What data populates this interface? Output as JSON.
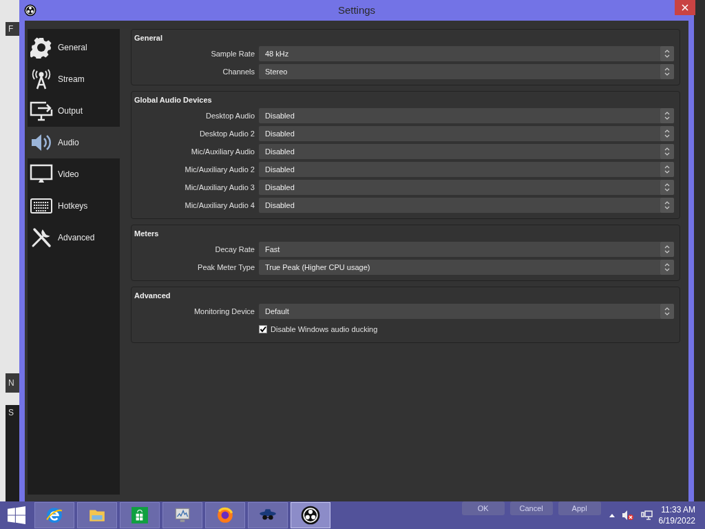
{
  "background_app": {
    "texts": [
      "F",
      "N",
      "S"
    ]
  },
  "window": {
    "title": "Settings"
  },
  "sidebar": {
    "items": [
      {
        "kind": "general",
        "label": "General",
        "selected": false
      },
      {
        "kind": "stream",
        "label": "Stream",
        "selected": false
      },
      {
        "kind": "output",
        "label": "Output",
        "selected": false
      },
      {
        "kind": "audio",
        "label": "Audio",
        "selected": true
      },
      {
        "kind": "video",
        "label": "Video",
        "selected": false
      },
      {
        "kind": "hotkeys",
        "label": "Hotkeys",
        "selected": false
      },
      {
        "kind": "advanced",
        "label": "Advanced",
        "selected": false
      }
    ]
  },
  "sections": [
    {
      "title": "General",
      "rows": [
        {
          "kind": "combo",
          "label": "Sample Rate",
          "value": "48 kHz"
        },
        {
          "kind": "combo",
          "label": "Channels",
          "value": "Stereo"
        }
      ]
    },
    {
      "title": "Global Audio Devices",
      "rows": [
        {
          "kind": "combo",
          "label": "Desktop Audio",
          "value": "Disabled"
        },
        {
          "kind": "combo",
          "label": "Desktop Audio 2",
          "value": "Disabled"
        },
        {
          "kind": "combo",
          "label": "Mic/Auxiliary Audio",
          "value": "Disabled"
        },
        {
          "kind": "combo",
          "label": "Mic/Auxiliary Audio 2",
          "value": "Disabled"
        },
        {
          "kind": "combo",
          "label": "Mic/Auxiliary Audio 3",
          "value": "Disabled"
        },
        {
          "kind": "combo",
          "label": "Mic/Auxiliary Audio 4",
          "value": "Disabled"
        }
      ]
    },
    {
      "title": "Meters",
      "rows": [
        {
          "kind": "combo",
          "label": "Decay Rate",
          "value": "Fast"
        },
        {
          "kind": "combo",
          "label": "Peak Meter Type",
          "value": "True Peak (Higher CPU usage)"
        }
      ]
    },
    {
      "title": "Advanced",
      "rows": [
        {
          "kind": "combo",
          "label": "Monitoring Device",
          "value": "Default"
        },
        {
          "kind": "checkbox",
          "label": "Disable Windows audio ducking",
          "checked": true
        }
      ]
    }
  ],
  "buttons": [
    "OK",
    "Cancel",
    "Appl"
  ],
  "taskbar": {
    "apps": [
      {
        "kind": "browser",
        "selected": false
      },
      {
        "kind": "folder",
        "selected": false
      },
      {
        "kind": "store",
        "selected": false
      },
      {
        "kind": "monitor",
        "selected": false
      },
      {
        "kind": "firefox",
        "selected": false
      },
      {
        "kind": "spy",
        "selected": false
      },
      {
        "kind": "obs",
        "selected": true
      }
    ],
    "clock": {
      "time": "11:33 AM",
      "date": "6/19/2022"
    }
  }
}
